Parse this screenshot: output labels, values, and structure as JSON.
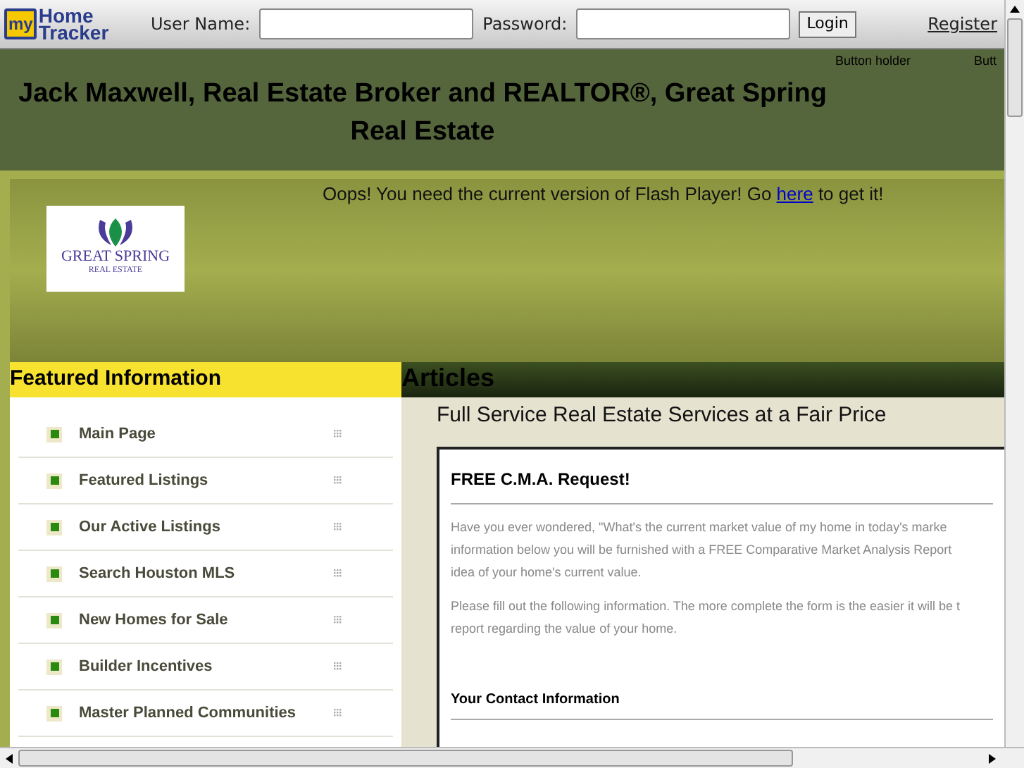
{
  "topbar": {
    "logo": {
      "badge": "my",
      "line1": "Home",
      "line2": "Tracker"
    },
    "username_label": "User Name:",
    "password_label": "Password:",
    "login": "Login",
    "register": "Register"
  },
  "header": {
    "button_holders": [
      "Button holder",
      "Butt"
    ],
    "title_line1": "Jack Maxwell, Real Estate Broker and REALTOR®, Great Spring",
    "title_line2": "Real Estate"
  },
  "flash": {
    "before": "Oops! You need the current version of Flash Player! Go ",
    "link": "here",
    "after": " to get it!"
  },
  "brand_logo": {
    "name": "GREAT SPRING",
    "sub": "REAL ESTATE"
  },
  "sidebar": {
    "title": "Featured Information",
    "items": [
      "Main Page",
      "Featured Listings",
      "Our Active Listings",
      "Search Houston MLS",
      "New Homes for Sale",
      "Builder Incentives",
      "Master Planned Communities"
    ]
  },
  "content": {
    "heading": "Articles",
    "subheading": "Full Service Real Estate Services at a Fair Price",
    "form": {
      "title": "FREE C.M.A. Request!",
      "paragraphs": [
        [
          "Have you ever wondered, \"What's the current market value of my home in today's marke",
          "information below you will be furnished with a FREE Comparative Market Analysis Report",
          "idea of your home's current value."
        ],
        [
          "Please fill out the following information. The more complete the form is the easier it will be t",
          "report regarding the value of your home."
        ]
      ],
      "section": "Your Contact Information"
    }
  }
}
